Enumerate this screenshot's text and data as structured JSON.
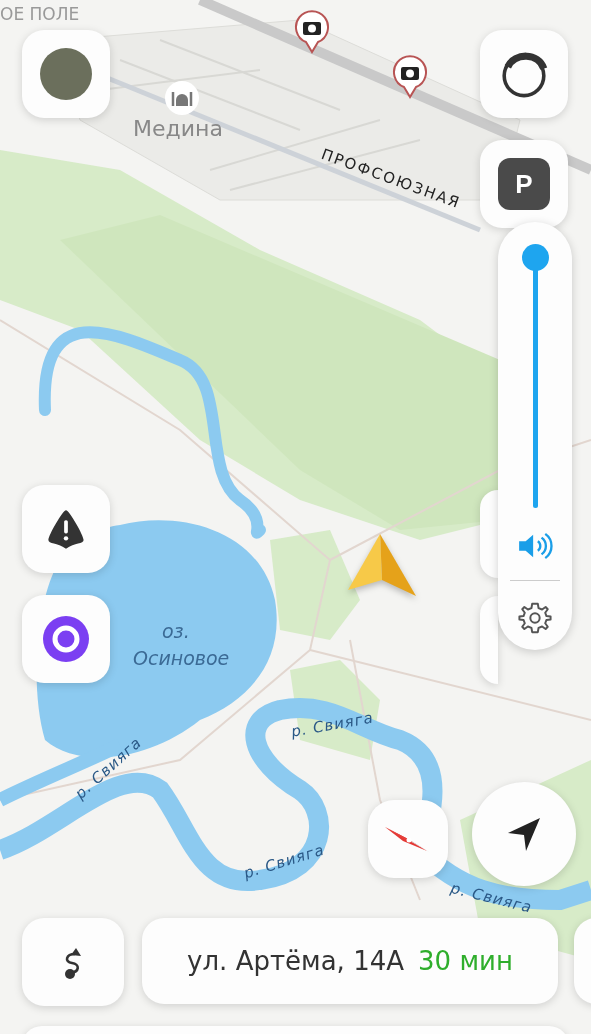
{
  "map_labels": [
    {
      "kind": "district",
      "text": "ОЕ ПОЛЕ"
    },
    {
      "kind": "place",
      "text": "Медина"
    },
    {
      "kind": "street",
      "text": "ПРОФСОЮЗНАЯ"
    },
    {
      "kind": "water",
      "text": "оз."
    },
    {
      "kind": "water",
      "text": "Осиновое"
    },
    {
      "kind": "river",
      "text": "р. Свияга"
    },
    {
      "kind": "river",
      "text": "р. Свияга"
    },
    {
      "kind": "river",
      "text": "р. Свияга"
    },
    {
      "kind": "river",
      "text": "р. Свияга"
    }
  ],
  "parking_button": {
    "label": "P"
  },
  "volume": {
    "level": 1
  },
  "route": {
    "address": "ул. Артёма, 14А",
    "eta": "30 мин"
  }
}
